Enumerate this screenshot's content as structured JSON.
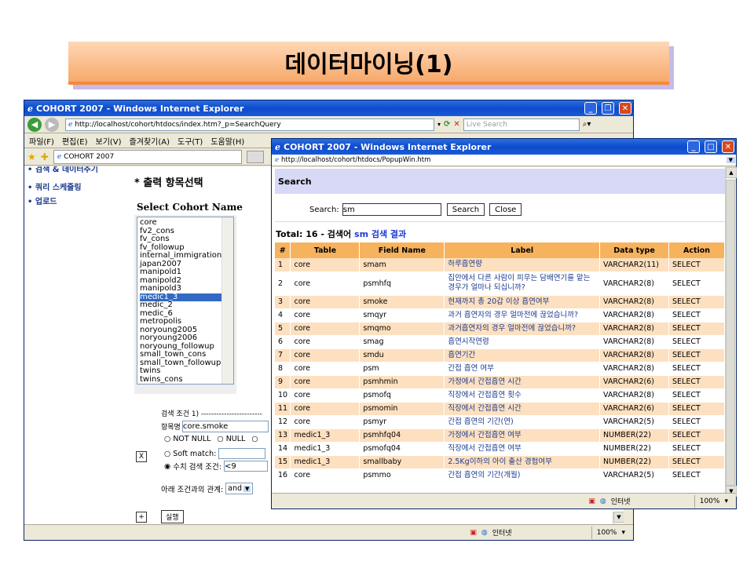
{
  "slide": {
    "title": "데이터마이닝(1)"
  },
  "main_window": {
    "title": "COHORT 2007 - Windows Internet Explorer",
    "url": "http://localhost/cohort/htdocs/index.htm?_p=SearchQuery",
    "search_placeholder": "Live Search",
    "menu": [
      "파일(F)",
      "편집(E)",
      "보기(V)",
      "즐겨찾기(A)",
      "도구(T)",
      "도움말(H)"
    ],
    "tab_label": "COHORT 2007",
    "sidebar": [
      "쿼리 스케줄링",
      "업로드"
    ],
    "sidebar_partial": "• 검색 & 데이터추기",
    "section_title": "* 출력 항목선택",
    "cohort_label": "Select Cohort Name",
    "cohorts": [
      "core",
      "fv2_cons",
      "fv_cons",
      "fv_followup",
      "internal_immigration",
      "japan2007",
      "manipold1",
      "manipold2",
      "manipold3",
      "medic1_3",
      "medic_2",
      "medic_6",
      "metropolis",
      "noryoung2005",
      "noryoung2006",
      "noryoung_followup",
      "small_town_cons",
      "small_town_followup",
      "twins",
      "twins_cons"
    ],
    "selected_cohort": "medic1_3",
    "condition_header": "검색 조건 1) ------------------------",
    "field_label": "항목명",
    "field_value": "core.smoke",
    "opt_not_null": "NOT NULL",
    "opt_null": "NULL",
    "opt_soft": "Soft match:",
    "opt_numeric": "수치 검색 조건:",
    "numeric_value": "<9",
    "relation_label": "아래 조건과의 관계:",
    "relation_value": "and",
    "x_label": "X",
    "plus_label": "+",
    "run_label": "실행",
    "status_zone": "인터넷",
    "zoom": "100%"
  },
  "popup_window": {
    "title": "COHORT 2007 - Windows Internet Explorer",
    "url": "http://localhost/cohort/htdocs/PopupWin.htm",
    "heading": "Search",
    "search_label": "Search:",
    "search_value": "sm",
    "search_button": "Search",
    "close_button": "Close",
    "total_prefix": "Total: 16 - 검색어 ",
    "total_term": "sm 검색 결과",
    "columns": [
      "#",
      "Table",
      "Field Name",
      "Label",
      "Data type",
      "Action"
    ],
    "rows": [
      [
        "1",
        "core",
        "smam",
        "하루흡연량",
        "VARCHAR2(11)",
        "SELECT"
      ],
      [
        "2",
        "core",
        "psmhfq",
        "집안에서 다른 사람이 피우는 담배연기를 맡는 경우가 얼마나 되십니까?",
        "VARCHAR2(8)",
        "SELECT"
      ],
      [
        "3",
        "core",
        "smoke",
        "현재까지 총 20갑 이상 흡연여부",
        "VARCHAR2(8)",
        "SELECT"
      ],
      [
        "4",
        "core",
        "smqyr",
        "과거 흡연자의 경우 얼마전에 끊었습니까?",
        "VARCHAR2(8)",
        "SELECT"
      ],
      [
        "5",
        "core",
        "smqmo",
        "과거흡연자의 경우 얼마전에 끊었습니까?",
        "VARCHAR2(8)",
        "SELECT"
      ],
      [
        "6",
        "core",
        "smag",
        "흡연시작연령",
        "VARCHAR2(8)",
        "SELECT"
      ],
      [
        "7",
        "core",
        "smdu",
        "흡연기간",
        "VARCHAR2(8)",
        "SELECT"
      ],
      [
        "8",
        "core",
        "psm",
        "간접 흡연 여부",
        "VARCHAR2(8)",
        "SELECT"
      ],
      [
        "9",
        "core",
        "psmhmin",
        "가정에서 간접흡연 시간",
        "VARCHAR2(6)",
        "SELECT"
      ],
      [
        "10",
        "core",
        "psmofq",
        "직장에서 간접흡연 횟수",
        "VARCHAR2(8)",
        "SELECT"
      ],
      [
        "11",
        "core",
        "psmomin",
        "직장에서 간접흡연 시간",
        "VARCHAR2(6)",
        "SELECT"
      ],
      [
        "12",
        "core",
        "psmyr",
        "간접 흡연의 기간(연)",
        "VARCHAR2(5)",
        "SELECT"
      ],
      [
        "13",
        "medic1_3",
        "psmhfq04",
        "가정에서 간접흡연 여부",
        "NUMBER(22)",
        "SELECT"
      ],
      [
        "14",
        "medic1_3",
        "psmofq04",
        "직장에서 간접흡연 여부",
        "NUMBER(22)",
        "SELECT"
      ],
      [
        "15",
        "medic1_3",
        "smallbaby",
        "2.5Kg이하의 아이 출산 경험여부",
        "NUMBER(22)",
        "SELECT"
      ],
      [
        "16",
        "core",
        "psmmo",
        "간접 흡연의 기간(개월)",
        "VARCHAR2(5)",
        "SELECT"
      ]
    ],
    "status_zone": "인터넷",
    "zoom": "100%"
  }
}
